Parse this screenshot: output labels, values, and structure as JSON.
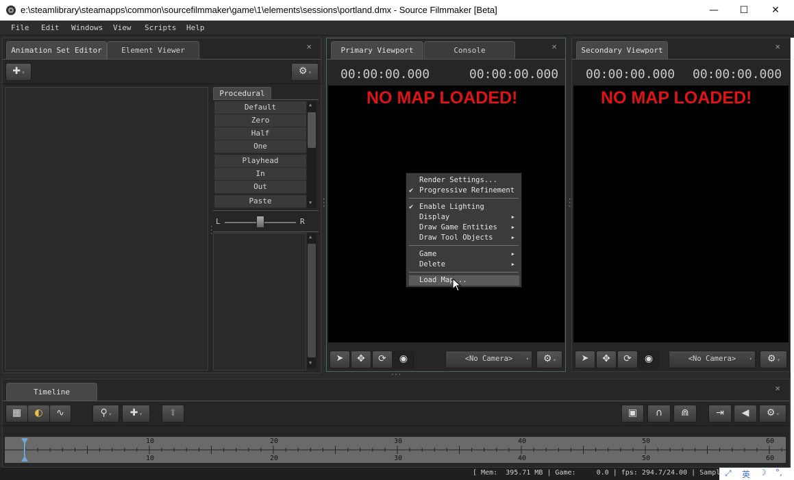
{
  "window": {
    "title": "e:\\steamlibrary\\steamapps\\common\\sourcefilmmaker\\game\\1\\elements\\sessions\\portland.dmx - Source Filmmaker [Beta]",
    "minimize": "—",
    "maximize": "☐",
    "close": "✕"
  },
  "menu": [
    "File",
    "Edit",
    "Windows",
    "View",
    "Scripts",
    "Help"
  ],
  "left_panel": {
    "tabs": [
      "Animation Set Editor",
      "Element Viewer"
    ],
    "procedural_tab": "Procedural",
    "presets": [
      "Default",
      "Zero",
      "Half",
      "One",
      "Playhead",
      "In",
      "Out",
      "Paste"
    ],
    "slider_left": "L",
    "slider_right": "R"
  },
  "primary_viewport": {
    "tabs": [
      "Primary Viewport",
      "Console"
    ],
    "time_left": "00:00:00.000",
    "time_right": "00:00:00.000",
    "message": "NO MAP LOADED!",
    "camera": "<No Camera>"
  },
  "secondary_viewport": {
    "tab": "Secondary Viewport",
    "time_left": "00:00:00.000",
    "time_right": "00:00:00.000",
    "message": "NO MAP LOADED!",
    "camera": "<No Camera>"
  },
  "context_menu": {
    "items": {
      "render_settings": "Render Settings...",
      "progressive_refinement": "Progressive Refinement",
      "enable_lighting": "Enable Lighting",
      "display": "Display",
      "draw_game_entities": "Draw Game Entities",
      "draw_tool_objects": "Draw Tool Objects",
      "game": "Game",
      "delete": "Delete",
      "load_map": "Load Map..."
    },
    "checked": [
      "Progressive Refinement",
      "Enable Lighting"
    ],
    "highlighted": "Load Map..."
  },
  "timeline": {
    "tab": "Timeline",
    "ticks": [
      "10",
      "20",
      "30",
      "40",
      "50",
      "60"
    ]
  },
  "status": {
    "text": "[ Mem:  395.71 MB | Game:     0.0 | fps: 294.7/24.00 | Sampl",
    "ime": "英"
  },
  "colors": {
    "no_map": "#e01414",
    "panel_bg": "#262626",
    "viewport_bg": "#000000"
  }
}
